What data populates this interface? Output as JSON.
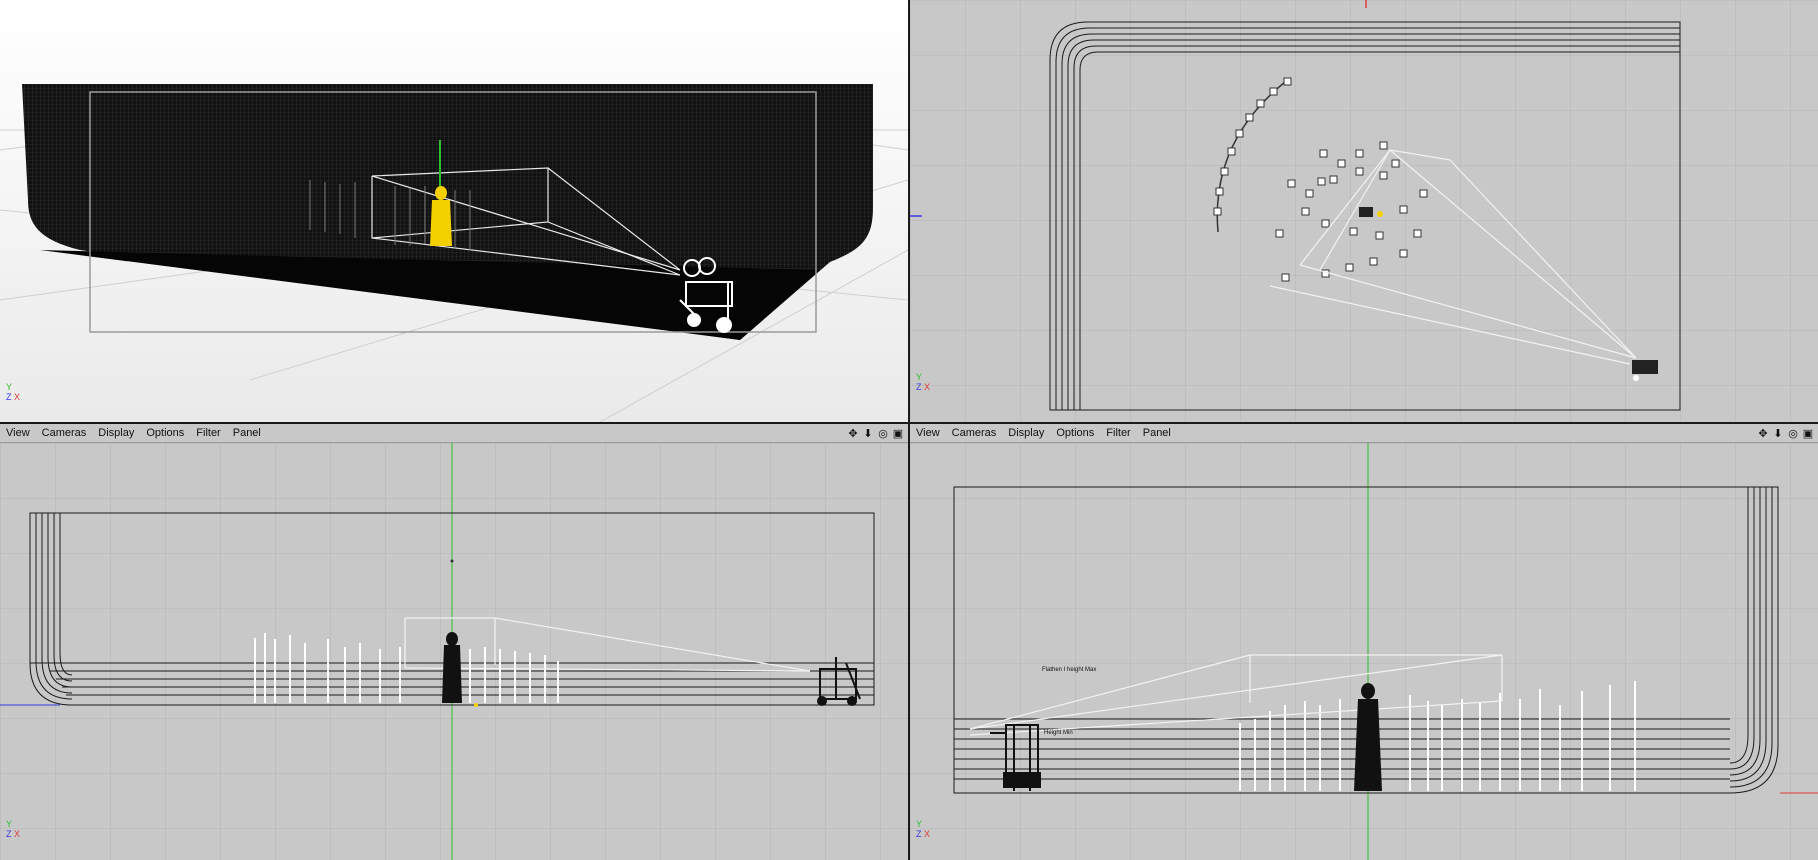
{
  "menu": {
    "items": [
      "View",
      "Cameras",
      "Display",
      "Options",
      "Filter",
      "Panel"
    ],
    "tools": [
      "move-icon",
      "download-icon",
      "camera-icon",
      "layout-icon"
    ]
  },
  "axes": {
    "y": "Y",
    "z": "Z",
    "x": "X"
  },
  "annotations": {
    "a": "Flathen I height Max",
    "b": "Height Min"
  },
  "colors": {
    "viewport_bg": "#c8c8c8",
    "grid": "#b4b4b4",
    "figure_selected": "#f5d000",
    "axis_green": "#2bbf2b",
    "axis_red": "#e03a3a",
    "axis_blue": "#3a3ae0"
  }
}
